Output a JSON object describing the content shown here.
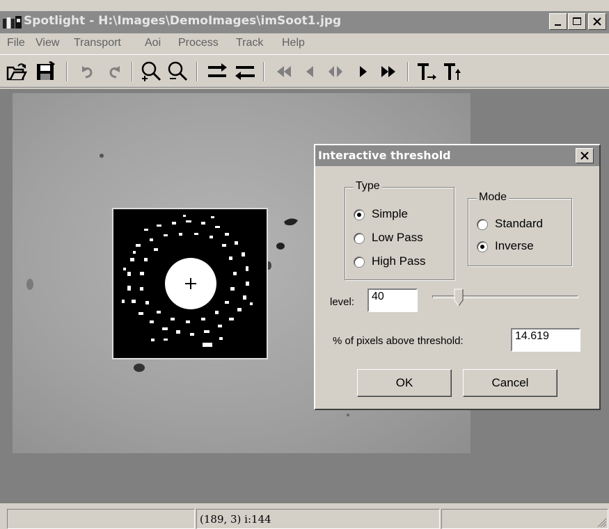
{
  "window": {
    "title": "Spotlight - H:\\Images\\DemoImages\\imSoot1.jpg"
  },
  "menu": [
    "File",
    "View",
    "Transport",
    "Aoi",
    "Process",
    "Track",
    "Help"
  ],
  "toolbar_icons": [
    "open-folder",
    "save",
    "undo",
    "redo",
    "zoom-in",
    "zoom-out",
    "arrow-right",
    "arrow-left",
    "rewind",
    "step-back",
    "play-both",
    "step-forward",
    "fast-forward",
    "track-forward",
    "track-back"
  ],
  "dialog": {
    "title": "Interactive threshold",
    "type_group": {
      "label": "Type",
      "options": [
        "Simple",
        "Low Pass",
        "High Pass"
      ],
      "selected": "Simple"
    },
    "mode_group": {
      "label": "Mode",
      "options": [
        "Standard",
        "Inverse"
      ],
      "selected": "Inverse"
    },
    "level_label": "level:",
    "level_value": "40",
    "level_slider_fraction": 0.18,
    "pixels_label": "% of pixels above threshold:",
    "pixels_value": "14.619",
    "ok_label": "OK",
    "cancel_label": "Cancel"
  },
  "status": {
    "coords": "(189,   3) i:144"
  },
  "colors": {
    "face": "#d4d0c8",
    "titlebar_inactive": "#8a8a8a",
    "client_background": "#808080"
  }
}
